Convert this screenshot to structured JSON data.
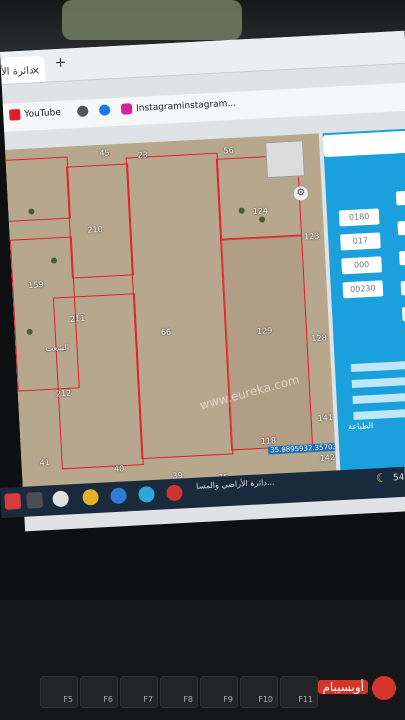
{
  "browser": {
    "tab_title": "دائرة الأ",
    "tab_close": "×",
    "new_tab": "+",
    "bookmarks": [
      {
        "icon": "youtube-icon",
        "label": "YouTube"
      },
      {
        "icon": "globe-icon",
        "label": ""
      },
      {
        "icon": "facebook-icon",
        "label": ""
      },
      {
        "icon": "instagram-icon",
        "label": "Instagraminstagram..."
      }
    ]
  },
  "map": {
    "parcels": [
      "45",
      "23",
      "56",
      "210",
      "124",
      "123",
      "159",
      "211",
      "66",
      "129",
      "128",
      "212",
      "141",
      "41",
      "40",
      "39",
      "15",
      "118",
      "142"
    ],
    "place_label": "الشعب",
    "watermark": "www.eureka.com",
    "coords": "35.8895932.35703"
  },
  "panel": {
    "inputs": [
      "0180",
      "017",
      "000",
      "00230"
    ],
    "print_label": "الطباعة"
  },
  "taskbar": {
    "window_title": "دائرة الأراضي والمسا...",
    "battery": "54"
  },
  "keyboard": {
    "keys": [
      "F5",
      "F6",
      "F7",
      "F8",
      "F9",
      "F10",
      "F11"
    ]
  },
  "logo": "أوبسيبام"
}
